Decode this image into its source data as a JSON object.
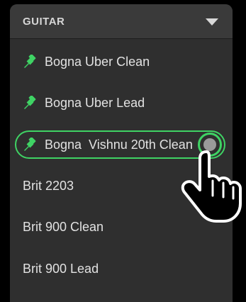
{
  "dropdown": {
    "title": "GUITAR",
    "chevron_icon": "chevron-down-icon"
  },
  "list": {
    "items": [
      {
        "label": "Bogna Uber Clean",
        "pinned": true,
        "selected": false
      },
      {
        "label": "Bogna Uber Lead",
        "pinned": true,
        "selected": false
      },
      {
        "label": "Bogna  Vishnu 20th Clean",
        "pinned": true,
        "selected": true
      },
      {
        "label": "Brit 2203",
        "pinned": false,
        "selected": false
      },
      {
        "label": "Brit 900 Clean",
        "pinned": false,
        "selected": false
      },
      {
        "label": "Brit 900 Lead",
        "pinned": false,
        "selected": false
      }
    ]
  },
  "colors": {
    "accent": "#3fd364",
    "panel": "#2f2f2f",
    "header": "#3a3a3a",
    "text": "#e2e2e2"
  },
  "icons": {
    "pin": "pin-icon",
    "cursor": "hand-pointer-icon"
  }
}
